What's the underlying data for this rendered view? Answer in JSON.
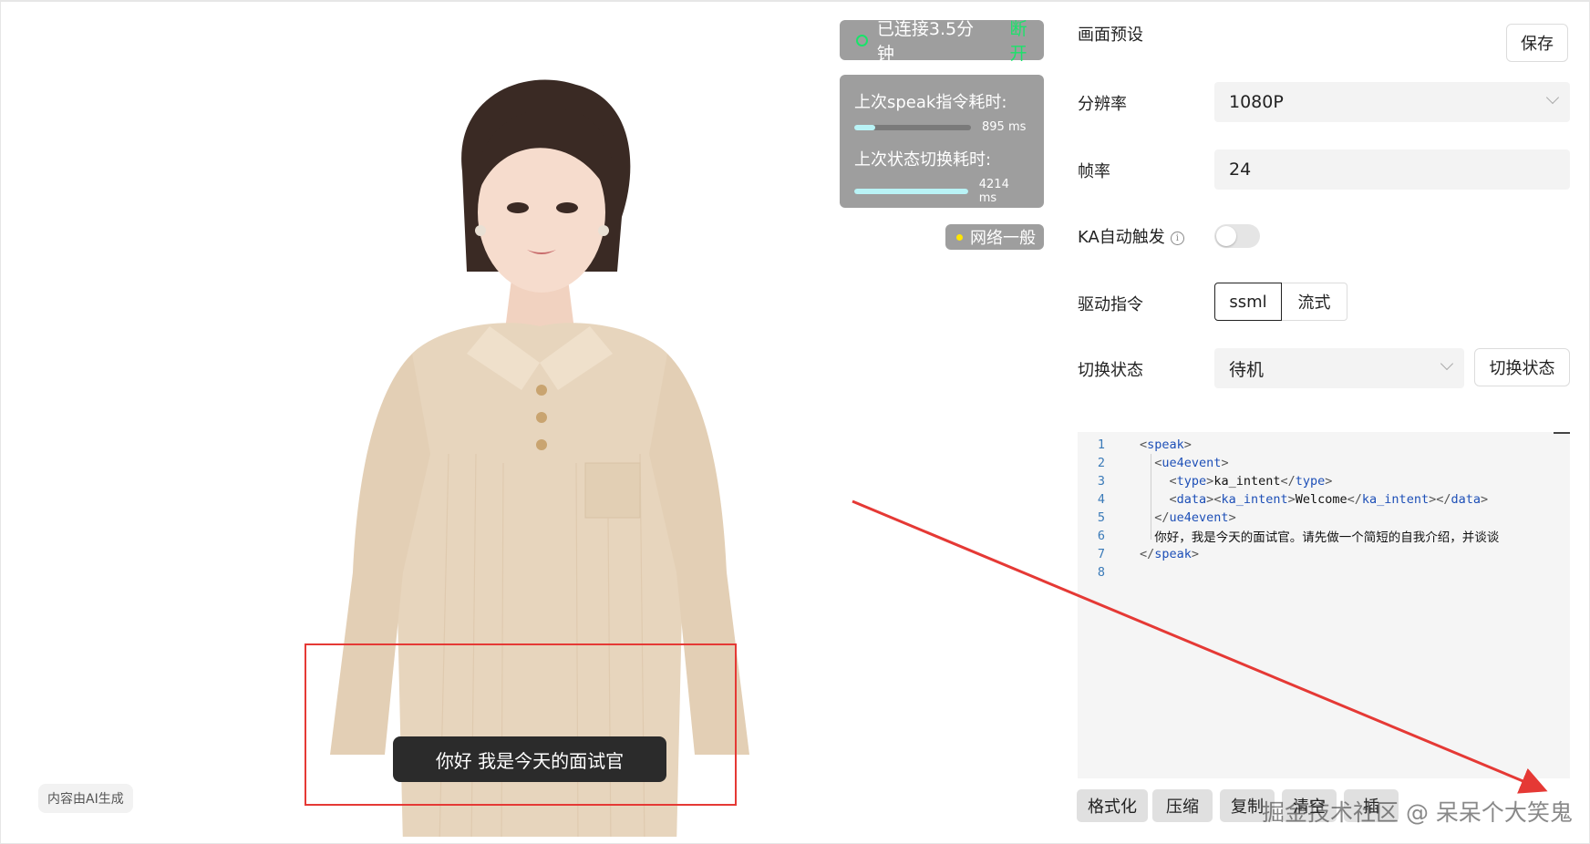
{
  "status": {
    "connection_text": "已连接3.5分钟",
    "disconnect_label": "断开",
    "metrics": [
      {
        "label": "上次speak指令耗时:",
        "value": "895 ms",
        "fill": 0.18
      },
      {
        "label": "上次状态切换耗时:",
        "value": "4214 ms",
        "fill": 1.0
      }
    ],
    "network_text": "网络一般"
  },
  "stage": {
    "ai_badge": "内容由AI生成",
    "subtitle": "你好 我是今天的面试官"
  },
  "panel": {
    "title": "画面预设",
    "save_label": "保存",
    "resolution": {
      "label": "分辨率",
      "value": "1080P"
    },
    "framerate": {
      "label": "帧率",
      "value": "24"
    },
    "ka_auto": {
      "label": "KA自动触发",
      "info_glyph": "i",
      "enabled": false
    },
    "drive_cmd": {
      "label": "驱动指令",
      "options": [
        "ssml",
        "流式"
      ],
      "selected": "ssml"
    },
    "switch_state": {
      "label": "切换状态",
      "value": "待机",
      "button_label": "切换状态"
    }
  },
  "editor": {
    "lines": [
      {
        "n": "1",
        "text": "<speak>"
      },
      {
        "n": "2",
        "text": "  <ue4event>"
      },
      {
        "n": "3",
        "text": "    <type>ka_intent</type>"
      },
      {
        "n": "4",
        "text": "    <data><ka_intent>Welcome</ka_intent></data>"
      },
      {
        "n": "5",
        "text": "  </ue4event>"
      },
      {
        "n": "6",
        "text": "  你好，我是今天的面试官。请先做一个简短的自我介绍，并谈谈"
      },
      {
        "n": "7",
        "text": "</speak>"
      },
      {
        "n": "8",
        "text": ""
      }
    ],
    "toolbar": [
      "格式化",
      "压缩",
      "复制",
      "清空",
      "插"
    ]
  },
  "watermark": "掘金技术社区 @ 呆呆个大笑鬼",
  "colors": {
    "accent_green": "#19e36a",
    "annotation_red": "#e53935",
    "network_yellow": "#ffe600"
  }
}
